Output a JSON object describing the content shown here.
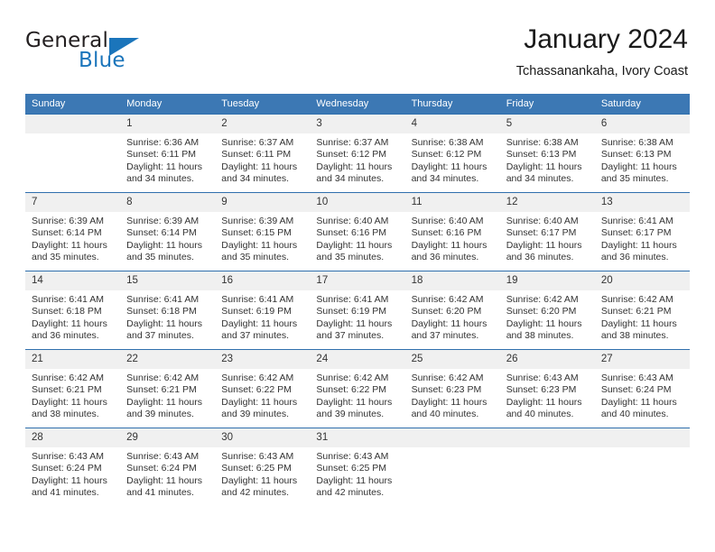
{
  "brand": {
    "name_part1": "General",
    "name_part2": "Blue",
    "accent_color": "#1b75bb"
  },
  "header": {
    "title": "January 2024",
    "subtitle": "Tchassanankaha, Ivory Coast"
  },
  "theme": {
    "header_row_bg": "#3c78b4",
    "row_divider": "#2f6fad",
    "daynum_bg": "#f0f0f0"
  },
  "calendar": {
    "weekday_headers": [
      "Sunday",
      "Monday",
      "Tuesday",
      "Wednesday",
      "Thursday",
      "Friday",
      "Saturday"
    ],
    "weeks": [
      [
        {
          "day": "",
          "sunrise": "",
          "sunset": "",
          "daylight_line1": "",
          "daylight_line2": ""
        },
        {
          "day": "1",
          "sunrise": "Sunrise: 6:36 AM",
          "sunset": "Sunset: 6:11 PM",
          "daylight_line1": "Daylight: 11 hours",
          "daylight_line2": "and 34 minutes."
        },
        {
          "day": "2",
          "sunrise": "Sunrise: 6:37 AM",
          "sunset": "Sunset: 6:11 PM",
          "daylight_line1": "Daylight: 11 hours",
          "daylight_line2": "and 34 minutes."
        },
        {
          "day": "3",
          "sunrise": "Sunrise: 6:37 AM",
          "sunset": "Sunset: 6:12 PM",
          "daylight_line1": "Daylight: 11 hours",
          "daylight_line2": "and 34 minutes."
        },
        {
          "day": "4",
          "sunrise": "Sunrise: 6:38 AM",
          "sunset": "Sunset: 6:12 PM",
          "daylight_line1": "Daylight: 11 hours",
          "daylight_line2": "and 34 minutes."
        },
        {
          "day": "5",
          "sunrise": "Sunrise: 6:38 AM",
          "sunset": "Sunset: 6:13 PM",
          "daylight_line1": "Daylight: 11 hours",
          "daylight_line2": "and 34 minutes."
        },
        {
          "day": "6",
          "sunrise": "Sunrise: 6:38 AM",
          "sunset": "Sunset: 6:13 PM",
          "daylight_line1": "Daylight: 11 hours",
          "daylight_line2": "and 35 minutes."
        }
      ],
      [
        {
          "day": "7",
          "sunrise": "Sunrise: 6:39 AM",
          "sunset": "Sunset: 6:14 PM",
          "daylight_line1": "Daylight: 11 hours",
          "daylight_line2": "and 35 minutes."
        },
        {
          "day": "8",
          "sunrise": "Sunrise: 6:39 AM",
          "sunset": "Sunset: 6:14 PM",
          "daylight_line1": "Daylight: 11 hours",
          "daylight_line2": "and 35 minutes."
        },
        {
          "day": "9",
          "sunrise": "Sunrise: 6:39 AM",
          "sunset": "Sunset: 6:15 PM",
          "daylight_line1": "Daylight: 11 hours",
          "daylight_line2": "and 35 minutes."
        },
        {
          "day": "10",
          "sunrise": "Sunrise: 6:40 AM",
          "sunset": "Sunset: 6:16 PM",
          "daylight_line1": "Daylight: 11 hours",
          "daylight_line2": "and 35 minutes."
        },
        {
          "day": "11",
          "sunrise": "Sunrise: 6:40 AM",
          "sunset": "Sunset: 6:16 PM",
          "daylight_line1": "Daylight: 11 hours",
          "daylight_line2": "and 36 minutes."
        },
        {
          "day": "12",
          "sunrise": "Sunrise: 6:40 AM",
          "sunset": "Sunset: 6:17 PM",
          "daylight_line1": "Daylight: 11 hours",
          "daylight_line2": "and 36 minutes."
        },
        {
          "day": "13",
          "sunrise": "Sunrise: 6:41 AM",
          "sunset": "Sunset: 6:17 PM",
          "daylight_line1": "Daylight: 11 hours",
          "daylight_line2": "and 36 minutes."
        }
      ],
      [
        {
          "day": "14",
          "sunrise": "Sunrise: 6:41 AM",
          "sunset": "Sunset: 6:18 PM",
          "daylight_line1": "Daylight: 11 hours",
          "daylight_line2": "and 36 minutes."
        },
        {
          "day": "15",
          "sunrise": "Sunrise: 6:41 AM",
          "sunset": "Sunset: 6:18 PM",
          "daylight_line1": "Daylight: 11 hours",
          "daylight_line2": "and 37 minutes."
        },
        {
          "day": "16",
          "sunrise": "Sunrise: 6:41 AM",
          "sunset": "Sunset: 6:19 PM",
          "daylight_line1": "Daylight: 11 hours",
          "daylight_line2": "and 37 minutes."
        },
        {
          "day": "17",
          "sunrise": "Sunrise: 6:41 AM",
          "sunset": "Sunset: 6:19 PM",
          "daylight_line1": "Daylight: 11 hours",
          "daylight_line2": "and 37 minutes."
        },
        {
          "day": "18",
          "sunrise": "Sunrise: 6:42 AM",
          "sunset": "Sunset: 6:20 PM",
          "daylight_line1": "Daylight: 11 hours",
          "daylight_line2": "and 37 minutes."
        },
        {
          "day": "19",
          "sunrise": "Sunrise: 6:42 AM",
          "sunset": "Sunset: 6:20 PM",
          "daylight_line1": "Daylight: 11 hours",
          "daylight_line2": "and 38 minutes."
        },
        {
          "day": "20",
          "sunrise": "Sunrise: 6:42 AM",
          "sunset": "Sunset: 6:21 PM",
          "daylight_line1": "Daylight: 11 hours",
          "daylight_line2": "and 38 minutes."
        }
      ],
      [
        {
          "day": "21",
          "sunrise": "Sunrise: 6:42 AM",
          "sunset": "Sunset: 6:21 PM",
          "daylight_line1": "Daylight: 11 hours",
          "daylight_line2": "and 38 minutes."
        },
        {
          "day": "22",
          "sunrise": "Sunrise: 6:42 AM",
          "sunset": "Sunset: 6:21 PM",
          "daylight_line1": "Daylight: 11 hours",
          "daylight_line2": "and 39 minutes."
        },
        {
          "day": "23",
          "sunrise": "Sunrise: 6:42 AM",
          "sunset": "Sunset: 6:22 PM",
          "daylight_line1": "Daylight: 11 hours",
          "daylight_line2": "and 39 minutes."
        },
        {
          "day": "24",
          "sunrise": "Sunrise: 6:42 AM",
          "sunset": "Sunset: 6:22 PM",
          "daylight_line1": "Daylight: 11 hours",
          "daylight_line2": "and 39 minutes."
        },
        {
          "day": "25",
          "sunrise": "Sunrise: 6:42 AM",
          "sunset": "Sunset: 6:23 PM",
          "daylight_line1": "Daylight: 11 hours",
          "daylight_line2": "and 40 minutes."
        },
        {
          "day": "26",
          "sunrise": "Sunrise: 6:43 AM",
          "sunset": "Sunset: 6:23 PM",
          "daylight_line1": "Daylight: 11 hours",
          "daylight_line2": "and 40 minutes."
        },
        {
          "day": "27",
          "sunrise": "Sunrise: 6:43 AM",
          "sunset": "Sunset: 6:24 PM",
          "daylight_line1": "Daylight: 11 hours",
          "daylight_line2": "and 40 minutes."
        }
      ],
      [
        {
          "day": "28",
          "sunrise": "Sunrise: 6:43 AM",
          "sunset": "Sunset: 6:24 PM",
          "daylight_line1": "Daylight: 11 hours",
          "daylight_line2": "and 41 minutes."
        },
        {
          "day": "29",
          "sunrise": "Sunrise: 6:43 AM",
          "sunset": "Sunset: 6:24 PM",
          "daylight_line1": "Daylight: 11 hours",
          "daylight_line2": "and 41 minutes."
        },
        {
          "day": "30",
          "sunrise": "Sunrise: 6:43 AM",
          "sunset": "Sunset: 6:25 PM",
          "daylight_line1": "Daylight: 11 hours",
          "daylight_line2": "and 42 minutes."
        },
        {
          "day": "31",
          "sunrise": "Sunrise: 6:43 AM",
          "sunset": "Sunset: 6:25 PM",
          "daylight_line1": "Daylight: 11 hours",
          "daylight_line2": "and 42 minutes."
        },
        {
          "day": "",
          "sunrise": "",
          "sunset": "",
          "daylight_line1": "",
          "daylight_line2": ""
        },
        {
          "day": "",
          "sunrise": "",
          "sunset": "",
          "daylight_line1": "",
          "daylight_line2": ""
        },
        {
          "day": "",
          "sunrise": "",
          "sunset": "",
          "daylight_line1": "",
          "daylight_line2": ""
        }
      ]
    ]
  }
}
